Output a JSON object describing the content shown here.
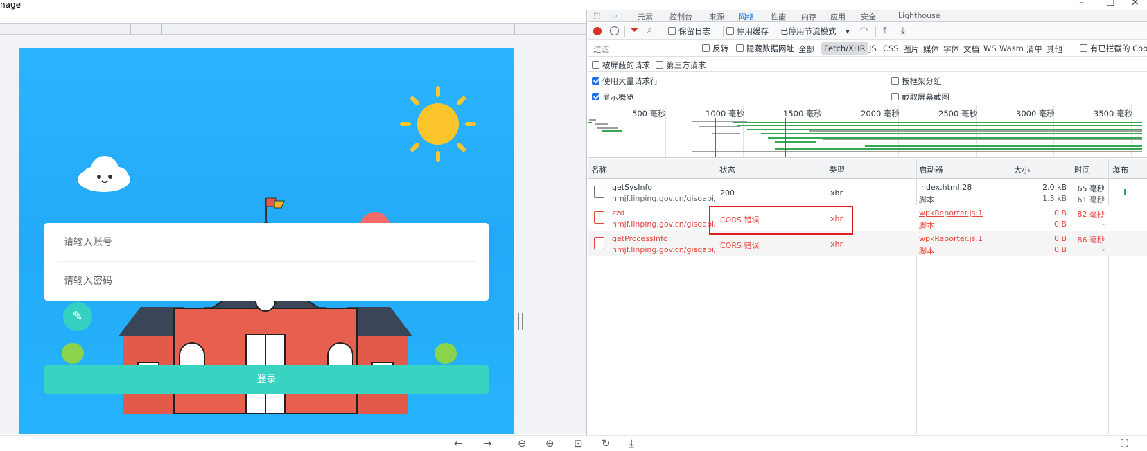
{
  "window": {
    "title": "nage"
  },
  "devtools": {
    "tabs": [
      "元素",
      "控制台",
      "来源",
      "网络",
      "性能",
      "内存",
      "应用",
      "安全",
      "Lighthouse"
    ],
    "toolbar": {
      "preserve_log": "保留日志",
      "disable_cache": "停用缓存",
      "throttling": "已停用节流模式"
    },
    "filter": {
      "placeholder": "过滤",
      "invert": "反转",
      "hide_data_urls": "隐藏数据网址",
      "types": [
        "全部",
        "Fetch/XHR",
        "JS",
        "CSS",
        "图片",
        "媒体",
        "字体",
        "文档",
        "WS",
        "Wasm",
        "清单",
        "其他"
      ],
      "selected_type": "Fetch/XHR",
      "blocked_cookies": "有已拦截的 Coo"
    },
    "options": {
      "blocked_requests": "被屏蔽的请求",
      "third_party": "第三方请求",
      "big_rows": "使用大量请求行",
      "group_by_frame": "按框架分组",
      "show_overview": "显示概览",
      "capture_screenshots": "截取屏幕截图"
    },
    "overview_ticks": [
      "500 毫秒",
      "1000 毫秒",
      "1500 毫秒",
      "2000 毫秒",
      "2500 毫秒",
      "3000 毫秒",
      "3500 毫秒"
    ],
    "columns": {
      "name": "名称",
      "status": "状态",
      "type": "类型",
      "initiator": "启动器",
      "size": "大小",
      "time": "时间",
      "waterfall": "瀑布"
    },
    "requests": [
      {
        "name": "getSysInfo",
        "url": "nmjf.linping.gov.cn/gisqapi/...",
        "status": "200",
        "type": "xhr",
        "initiator": "index.html:28",
        "initiator_type": "脚本",
        "size": "2.0 kB",
        "resource_size": "1.3 kB",
        "time": "65 毫秒",
        "latency": "61 毫秒",
        "error": false
      },
      {
        "name": "zzd",
        "url": "nmjf.linping.gov.cn/gisqapi/...",
        "status": "CORS 错误",
        "type": "xhr",
        "initiator": "wpkReporter.js:1",
        "initiator_type": "脚本",
        "size": "0 B",
        "resource_size": "0 B",
        "time": "82 毫秒",
        "latency": "-",
        "error": true
      },
      {
        "name": "getProcessInfo",
        "url": "nmjf.linping.gov.cn/gisqapi/...",
        "status": "CORS 错误",
        "type": "xhr",
        "initiator": "wpkReporter.js:1",
        "initiator_type": "脚本",
        "size": "0 B",
        "resource_size": "0 B",
        "time": "86 毫秒",
        "latency": "-",
        "error": true
      }
    ]
  },
  "page": {
    "account_placeholder": "请输入账号",
    "password_placeholder": "请输入密码",
    "login_label": "登录"
  },
  "colors": {
    "accent": "#1a73e8",
    "error": "#e8453c",
    "login_button": "#39d3c2",
    "page_bg": "#22aaf7",
    "highlight_box": "#e0201c"
  }
}
